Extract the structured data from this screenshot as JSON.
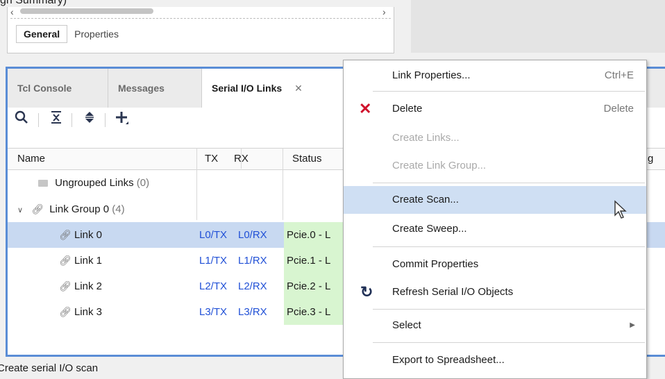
{
  "top_fragment": {
    "text": "gn Summary)",
    "tabs": [
      "General",
      "Properties"
    ]
  },
  "tabs": [
    {
      "label": "Tcl Console"
    },
    {
      "label": "Messages"
    },
    {
      "label": "Serial I/O Links",
      "active": true
    }
  ],
  "toolbar": {
    "icons": [
      "search-icon",
      "collapse-all-icon",
      "expand-all-icon",
      "add-icon"
    ]
  },
  "table": {
    "columns": [
      "Name",
      "TX",
      "RX",
      "Status",
      "g"
    ],
    "rows": [
      {
        "name": "Ungrouped Links",
        "count": "(0)",
        "type": "folder"
      },
      {
        "name": "Link Group 0",
        "count": "(4)",
        "type": "group"
      },
      {
        "name": "Link 0",
        "tx": "L0/TX",
        "rx": "L0/RX",
        "status": "Pcie.0 - L",
        "selected": true
      },
      {
        "name": "Link 1",
        "tx": "L1/TX",
        "rx": "L1/RX",
        "status": "Pcie.1 - L"
      },
      {
        "name": "Link 2",
        "tx": "L2/TX",
        "rx": "L2/RX",
        "status": "Pcie.2 - L"
      },
      {
        "name": "Link 3",
        "tx": "L3/TX",
        "rx": "L3/RX",
        "status": "Pcie.3 - L"
      }
    ]
  },
  "context_menu": {
    "items": [
      {
        "label": "Link Properties...",
        "shortcut": "Ctrl+E"
      },
      {
        "label": "Delete",
        "shortcut": "Delete",
        "icon": "delete-x-icon"
      },
      {
        "label": "Create Links...",
        "disabled": true
      },
      {
        "label": "Create Link Group...",
        "disabled": true
      },
      {
        "label": "Create Scan...",
        "hover": true
      },
      {
        "label": "Create Sweep..."
      },
      {
        "label": "Commit Properties"
      },
      {
        "label": "Refresh Serial I/O Objects",
        "icon": "refresh-icon"
      },
      {
        "label": "Select",
        "submenu": true
      },
      {
        "label": "Export to Spreadsheet..."
      }
    ]
  },
  "status_bar": {
    "text": "Create serial I/O scan"
  },
  "colors": {
    "accent": "#5a8dd6",
    "selected_row": "#c8d9f1",
    "status_green": "#d8f5d0",
    "link_blue": "#1f4fd6",
    "delete_red": "#d0112b"
  }
}
